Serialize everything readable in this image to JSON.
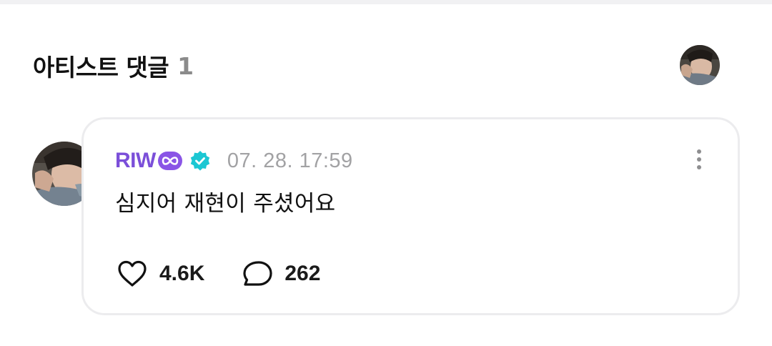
{
  "section": {
    "title": "아티스트 댓글",
    "count": "1"
  },
  "comment": {
    "author": "RIW",
    "timestamp": "07. 28. 17:59",
    "text": "심지어 재현이 주셨어요",
    "likes": "4.6K",
    "replies": "262"
  },
  "icons": {
    "author_badge": "infinity-badge-icon",
    "verified": "verified-check-icon",
    "more": "more-vertical-icon",
    "like": "heart-outline-icon",
    "reply": "speech-bubble-icon"
  },
  "colors": {
    "author_name": "#7b4fd9",
    "verified": "#1cc7d3",
    "timestamp": "#a2a2a4",
    "card_border": "#ececee"
  }
}
